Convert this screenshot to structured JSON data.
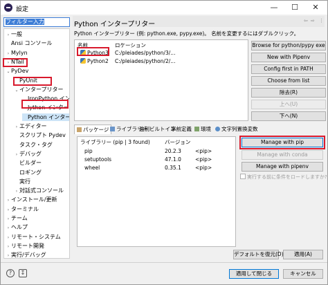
{
  "window": {
    "title": "設定",
    "minimize": "—",
    "maximize": "☐",
    "close": "✕"
  },
  "filter": {
    "value": "フィルター入力"
  },
  "tree": [
    {
      "label": "一般",
      "indent": 1,
      "expander": "›"
    },
    {
      "label": "Ansi コンソール",
      "indent": 1,
      "expander": ""
    },
    {
      "label": "Mylyn",
      "indent": 1,
      "expander": "›"
    },
    {
      "label": "NTail",
      "indent": 1,
      "expander": "›"
    },
    {
      "label": "PyDev",
      "indent": 0,
      "expander": "⌄"
    },
    {
      "label": "PyUnit",
      "indent": 2,
      "expander": ""
    },
    {
      "label": "インタープリター",
      "indent": 2,
      "expander": "⌄"
    },
    {
      "label": "IronPython インタ",
      "indent": 3,
      "expander": ""
    },
    {
      "label": "Jython インタープ",
      "indent": 3,
      "expander": ""
    },
    {
      "label": "Python インタープ!",
      "indent": 3,
      "expander": ""
    },
    {
      "label": "エディター",
      "indent": 2,
      "expander": "›"
    },
    {
      "label": "スクリプト Pydev",
      "indent": 2,
      "expander": ""
    },
    {
      "label": "タスク・タグ",
      "indent": 2,
      "expander": ""
    },
    {
      "label": "デバッグ",
      "indent": 2,
      "expander": "›"
    },
    {
      "label": "ビルダー",
      "indent": 2,
      "expander": ""
    },
    {
      "label": "ロギング",
      "indent": 2,
      "expander": ""
    },
    {
      "label": "実行",
      "indent": 2,
      "expander": ""
    },
    {
      "label": "対話式コンソール",
      "indent": 2,
      "expander": "›"
    },
    {
      "label": "インストール/更新",
      "indent": 1,
      "expander": "›"
    },
    {
      "label": "ターミナル",
      "indent": 1,
      "expander": "›"
    },
    {
      "label": "チーム",
      "indent": 1,
      "expander": "›"
    },
    {
      "label": "ヘルプ",
      "indent": 1,
      "expander": "›"
    },
    {
      "label": "リモート・システム",
      "indent": 1,
      "expander": "›"
    },
    {
      "label": "リモート開発",
      "indent": 1,
      "expander": "›"
    },
    {
      "label": "実行/デバッグ",
      "indent": 1,
      "expander": "›"
    }
  ],
  "header": {
    "title": "Python インタープリター",
    "nav_back": "⇦",
    "nav_fwd": "⇨",
    "nav_menu": "⋮"
  },
  "description": "Python インタープリター (例: python.exe, pypy.exe)。 名前を変更するにはダブルクリック。",
  "interpreters": {
    "col_name": "名前",
    "col_location": "ロケーション",
    "rows": [
      {
        "name": "Python3",
        "location": "C:/pleiades/python/3/..."
      },
      {
        "name": "Python2",
        "location": "C:/pleiades/python/2/..."
      }
    ]
  },
  "side_buttons": {
    "browse_pypy": "Browse for python/pypy exe",
    "new_pipenv": "New with Pipenv",
    "config_path": "Config first in PATH",
    "choose_list": "Choose from list",
    "remove": "除去(R)",
    "up": "上へ(U)",
    "down": "下へ(N)"
  },
  "tabs": {
    "packages": "パッケージ",
    "libraries": "ライブラリー",
    "forced": "強制ビルトイン",
    "predefined": "事前定義",
    "env": "環境",
    "strsub": "文字列置換変数"
  },
  "packages": {
    "col_library": "ライブラリー (pip | 3 found)",
    "col_version": "バージョン",
    "rows": [
      {
        "name": "pip",
        "version": "20.2.3",
        "source": "<pip>"
      },
      {
        "name": "setuptools",
        "version": "47.1.0",
        "source": "<pip>"
      },
      {
        "name": "wheel",
        "version": "0.35.1",
        "source": "<pip>"
      }
    ]
  },
  "pkg_buttons": {
    "manage_pip": "Manage with pip",
    "manage_conda": "Manage with conda",
    "manage_pipenv": "Manage with pipenv"
  },
  "load_check": "実行する前に条件をロードしますか?",
  "footer": {
    "restore": "デフォルトを復元(D)",
    "apply": "適用(A)",
    "apply_close": "適用して閉じる",
    "cancel": "キャンセル"
  }
}
